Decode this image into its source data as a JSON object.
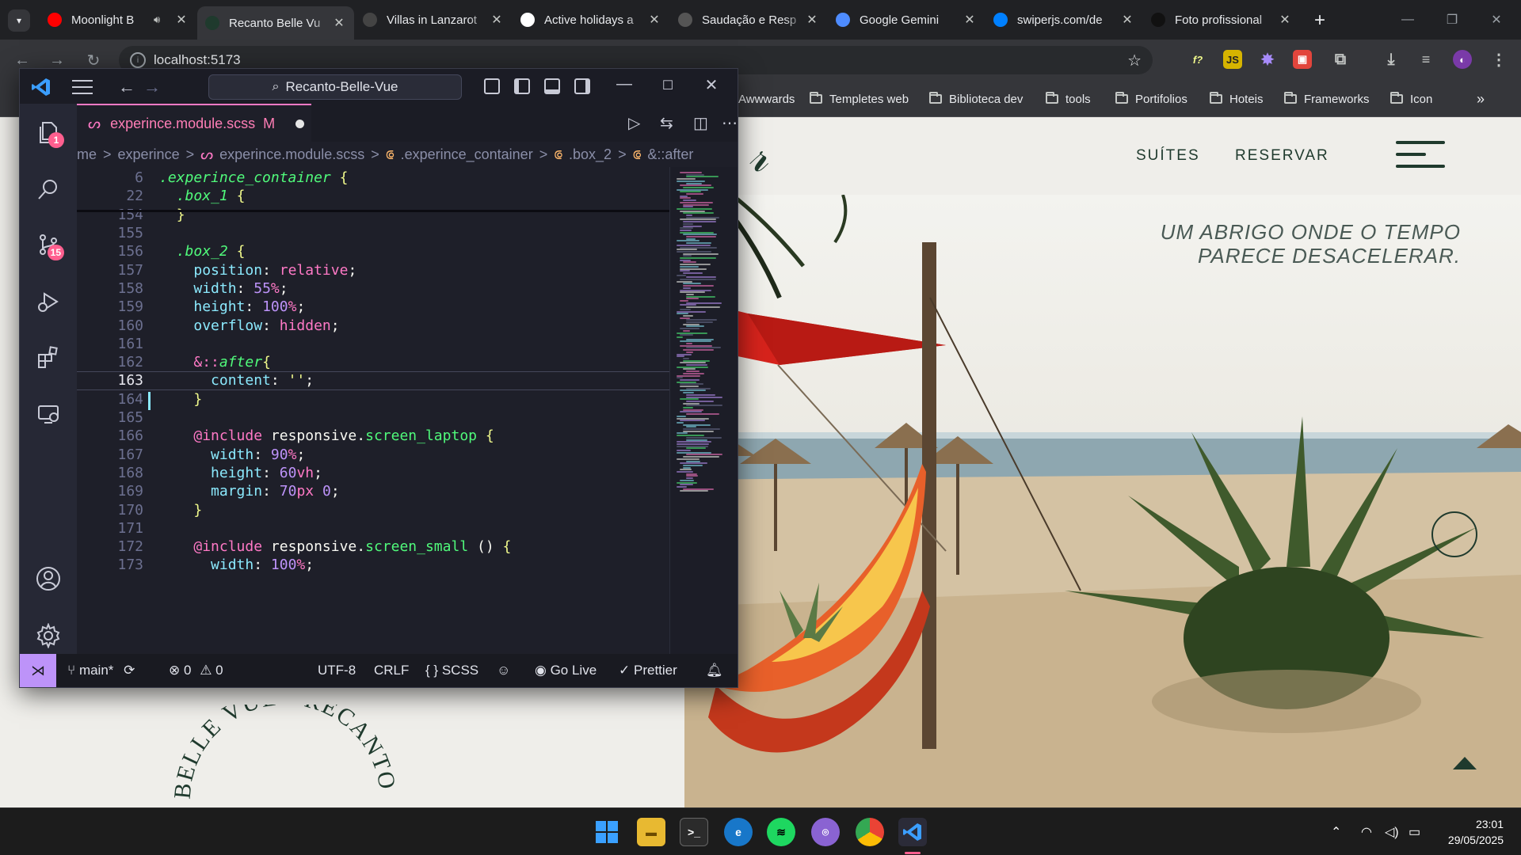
{
  "browser": {
    "tabs": [
      {
        "title": "Moonlight B",
        "favicon": "youtube-icon",
        "color": "#ff0000",
        "audio": true
      },
      {
        "title": "Recanto Belle Vu",
        "favicon": "site-logo-icon",
        "color": "#1f3a2d",
        "active": true
      },
      {
        "title": "Villas in Lanzarot",
        "favicon": "k-icon",
        "color": "#444444"
      },
      {
        "title": "Active holidays a",
        "favicon": "page-icon",
        "color": "#ffffff"
      },
      {
        "title": "Saudação e Resp",
        "favicon": "chatgpt-icon",
        "color": "#555555"
      },
      {
        "title": "Google Gemini",
        "favicon": "gemini-icon",
        "color": "#4e8cff"
      },
      {
        "title": "swiperjs.com/de",
        "favicon": "swiper-icon",
        "color": "#0080ff"
      },
      {
        "title": "Foto profissional",
        "favicon": "pinterest-icon",
        "color": "#111111"
      }
    ],
    "url": "localhost:5173",
    "bookmarks": [
      "Awwwards",
      "Templetes web",
      "Biblioteca dev",
      "tools",
      "Portifolios",
      "Hoteis",
      "Frameworks",
      "Icon"
    ]
  },
  "site": {
    "nav": {
      "suites": "SUÍTES",
      "reservar": "RESERVAR"
    },
    "tagline": [
      "UM ABRIGO ONDE O TEMPO",
      "PARECE DESACELERAR."
    ],
    "seal_text": "BELLE VUE • RECANTO BE"
  },
  "vscode": {
    "search": "Recanto-Belle-Vue",
    "badges": {
      "explorer": "1",
      "source_control": "15"
    },
    "tab": {
      "filename": "experince.module.scss",
      "status": "M"
    },
    "breadcrumb": [
      "me",
      "experince",
      "experince.module.scss",
      ".experince_container",
      ".box_2",
      "&::after"
    ],
    "sticky": [
      {
        "ln": "6",
        "text": ".experince_container {"
      },
      {
        "ln": "22",
        "text": "  .box_1 {"
      }
    ],
    "lines": [
      {
        "ln": "154",
        "text": "  }"
      },
      {
        "ln": "155",
        "text": ""
      },
      {
        "ln": "156",
        "text": "  .box_2 {"
      },
      {
        "ln": "157",
        "text": "    position: relative;"
      },
      {
        "ln": "158",
        "text": "    width: 55%;"
      },
      {
        "ln": "159",
        "text": "    height: 100%;"
      },
      {
        "ln": "160",
        "text": "    overflow: hidden;"
      },
      {
        "ln": "161",
        "text": ""
      },
      {
        "ln": "162",
        "text": "    &::after{"
      },
      {
        "ln": "163",
        "text": "      content: '';"
      },
      {
        "ln": "164",
        "text": "    }"
      },
      {
        "ln": "165",
        "text": ""
      },
      {
        "ln": "166",
        "text": "    @include responsive.screen_laptop {"
      },
      {
        "ln": "167",
        "text": "      width: 90%;"
      },
      {
        "ln": "168",
        "text": "      height: 60vh;"
      },
      {
        "ln": "169",
        "text": "      margin: 70px 0;"
      },
      {
        "ln": "170",
        "text": "    }"
      },
      {
        "ln": "171",
        "text": ""
      },
      {
        "ln": "172",
        "text": "    @include responsive.screen_small () {"
      },
      {
        "ln": "173",
        "text": "      width: 100%;"
      }
    ],
    "current_line": "163",
    "status": {
      "branch": "main*",
      "errors": "0",
      "warnings": "0",
      "encoding": "UTF-8",
      "eol": "CRLF",
      "language": "SCSS",
      "golive": "Go Live",
      "prettier": "Prettier"
    }
  },
  "taskbar": {
    "time": "23:01",
    "date": "29/05/2025"
  }
}
